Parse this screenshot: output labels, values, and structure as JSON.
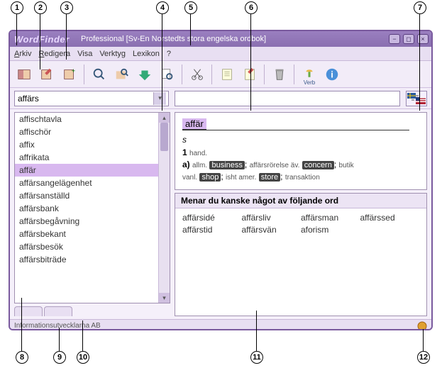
{
  "callouts": [
    "1",
    "2",
    "3",
    "4",
    "5",
    "6",
    "7",
    "8",
    "9",
    "10",
    "11",
    "12"
  ],
  "app_name": "WordFinder",
  "title": "Professional [Sv-En Norstedts stora engelska ordbok]",
  "menu": {
    "arkiv": "Arkiv",
    "redigera": "Redigera",
    "visa": "Visa",
    "verktyg": "Verktyg",
    "lexikon": "Lexikon",
    "help": "?"
  },
  "toolbar": {
    "verb_label": "Verb"
  },
  "search": {
    "value": "affärs"
  },
  "wordlist": [
    "affischtavla",
    "affischör",
    "affix",
    "affrikata",
    "affär",
    "affärsangelägenhet",
    "affärsanställd",
    "affärsbank",
    "affärsbegåvning",
    "affärsbekant",
    "affärsbesök",
    "affärsbiträde"
  ],
  "selected_index": 4,
  "definition": {
    "headword": "affär",
    "pos": "s",
    "sense1_num": "1",
    "sense1_domain": "hand.",
    "sense_a": "a)",
    "allm": "allm.",
    "t_business": "business",
    "aff_rorelse": "affärsrörelse äv.",
    "t_concern": "concern",
    "butik": "butik",
    "vanl": "vanl.",
    "t_shop": "shop",
    "isht_amer": "isht amer.",
    "t_store": "store",
    "transaktion": "transaktion"
  },
  "suggest": {
    "header": "Menar du kanske något av följande ord",
    "items": [
      "affärsidé",
      "affärsliv",
      "affärsman",
      "affärssed",
      "affärstid",
      "affärsvän",
      "aforism",
      ""
    ]
  },
  "status": "Informationsutvecklarna AB"
}
